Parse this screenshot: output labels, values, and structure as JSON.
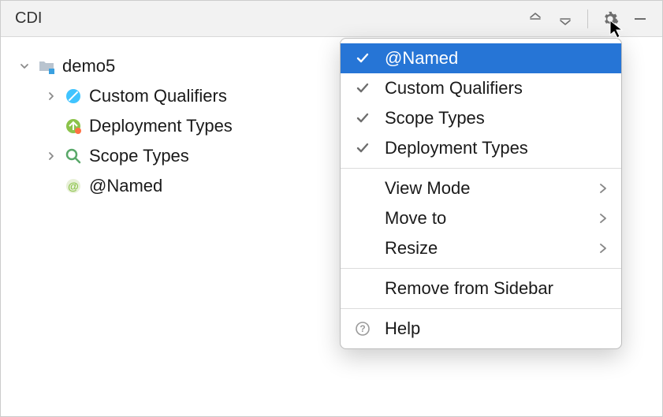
{
  "toolbar": {
    "title": "CDI"
  },
  "tree": {
    "root": {
      "label": "demo5"
    },
    "items": [
      {
        "label": "Custom Qualifiers"
      },
      {
        "label": "Deployment Types"
      },
      {
        "label": "Scope Types"
      },
      {
        "label": "@Named"
      }
    ]
  },
  "menu": {
    "toggles": [
      {
        "label": "@Named"
      },
      {
        "label": "Custom Qualifiers"
      },
      {
        "label": "Scope Types"
      },
      {
        "label": "Deployment Types"
      }
    ],
    "submenus": [
      {
        "label": "View Mode"
      },
      {
        "label": "Move to"
      },
      {
        "label": "Resize"
      }
    ],
    "remove": "Remove from Sidebar",
    "help": "Help"
  }
}
